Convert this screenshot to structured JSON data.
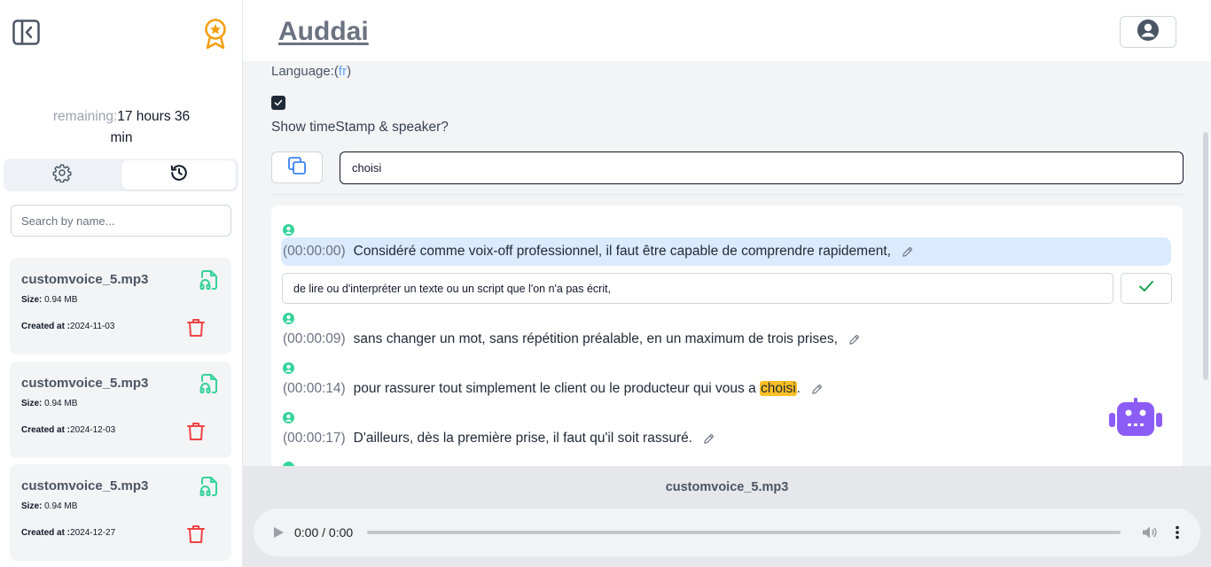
{
  "app": {
    "title": "Auddai"
  },
  "sidebar": {
    "remaining_label": "remaining:",
    "remaining_value": "17 hours 36",
    "remaining_unit": "min",
    "tabs": [
      {
        "icon": "gear-icon",
        "active": false
      },
      {
        "icon": "history-icon",
        "active": true
      }
    ],
    "search_placeholder": "Search by name...",
    "files": [
      {
        "name": "customvoice_5.mp3",
        "size_label": "Size:",
        "size": " 0.94 MB",
        "created_label": "Created at :",
        "created": "2024-11-03"
      },
      {
        "name": "customvoice_5.mp3",
        "size_label": "Size:",
        "size": " 0.94 MB",
        "created_label": "Created at :",
        "created": "2024-12-03"
      },
      {
        "name": "customvoice_5.mp3",
        "size_label": "Size:",
        "size": " 0.94 MB",
        "created_label": "Created at :",
        "created": "2024-12-27"
      }
    ]
  },
  "main": {
    "language_label": "Language:(",
    "language_code": "fr",
    "language_close": ")",
    "show_timestamp_checked": true,
    "show_timestamp_label": "Show timeStamp & speaker?",
    "find_value": "choisi",
    "segments": [
      {
        "ts": "(00:00:00)",
        "text": "Considéré comme voix-off professionnel, il faut être capable de comprendre rapidement,"
      },
      {
        "ts": "(00:00:09)",
        "text": "sans changer un mot, sans répétition préalable, en un maximum de trois prises,"
      },
      {
        "ts": "(00:00:14)",
        "text_before": "pour rassurer tout simplement le client ou le producteur qui vous a ",
        "highlight": "choisi",
        "text_after": "."
      },
      {
        "ts": "(00:00:17)",
        "text": "D'ailleurs, dès la première prise, il faut qu'il soit rassuré."
      }
    ],
    "edit_value": "de lire ou d'interpréter un texte ou un script que l'on n'a pas écrit,"
  },
  "player": {
    "title": "customvoice_5.mp3",
    "time": "0:00 / 0:00",
    "progress": 0
  },
  "colors": {
    "accent_green": "#34d399",
    "trash_red": "#ef4444",
    "highlight": "#fbbf24",
    "active_segment": "#dbeafe",
    "robot": "#8b5cf6"
  }
}
